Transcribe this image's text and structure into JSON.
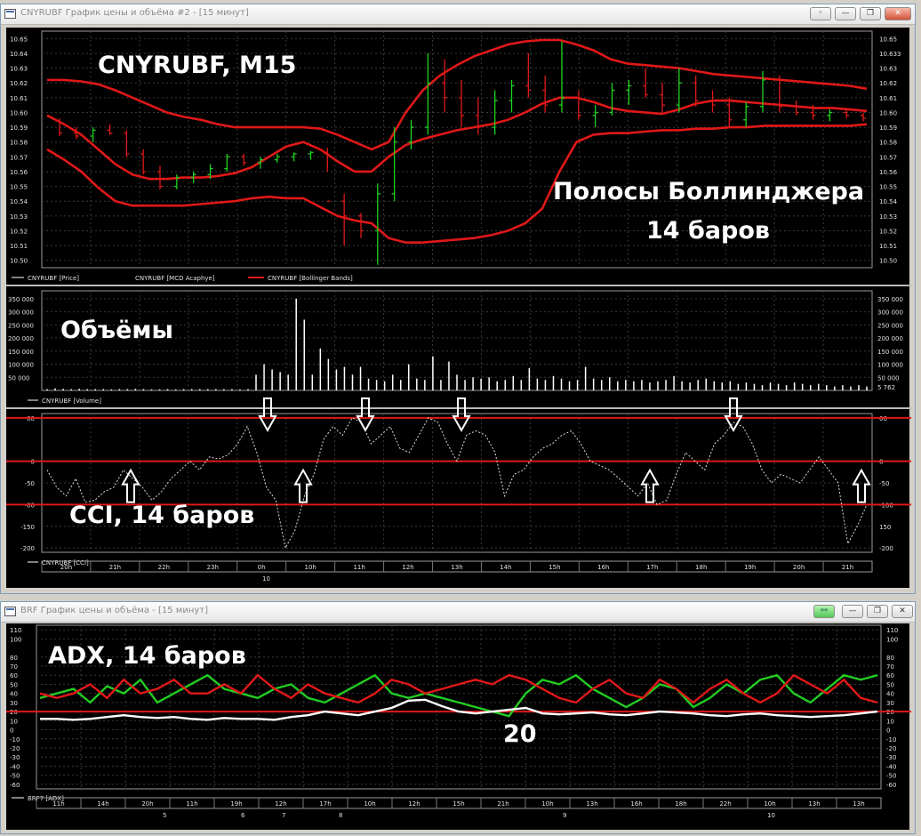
{
  "window1": {
    "title": "CNYRUBF График цены и объёма #2 - [15 минут]",
    "buttons": [
      "◦",
      "—",
      "❐",
      "✕"
    ]
  },
  "window2": {
    "title": "BRF График цены и объёма - [15 минут]",
    "buttons": [
      "⚯",
      "—",
      "❐",
      "✕"
    ]
  },
  "annotations": {
    "instrument": "CNYRUBF, M15",
    "bollinger_1": "Полосы Боллинджера",
    "bollinger_2": "14 баров",
    "volumes": "Объёмы",
    "cci": "CCI, 14 баров",
    "adx": "ADX, 14 баров",
    "adx_level": "20"
  },
  "colors": {
    "background": "#000000",
    "grid": "#3a3a3a",
    "bollinger": "#e01818",
    "bull": "#1fd41f",
    "bear": "#e01818",
    "axis_text": "#e0e0e0",
    "adx_green": "#22cc22",
    "adx_white": "#ffffff"
  },
  "chart_data": [
    {
      "type": "candlestick",
      "name": "price",
      "legend": [
        "CNYRUBF [Price]",
        "CNYRUBF [MCD Acaphye]",
        "CNYRUBF [Bollinger Bands]"
      ],
      "ylim": [
        10.495,
        10.655
      ],
      "yticks": [
        10.65,
        10.64,
        10.63,
        10.62,
        10.61,
        10.6,
        10.59,
        10.58,
        10.57,
        10.56,
        10.55,
        10.54,
        10.53,
        10.52,
        10.51,
        10.5
      ],
      "yticks_left": [
        "10.65",
        "10.64",
        "10.63",
        "10.62",
        "10.61",
        "10.60",
        "10.59",
        "10.58",
        "10.57",
        "10.56",
        "10.55",
        "10.54",
        "10.53",
        "10.52",
        "10.51",
        "10.50"
      ],
      "yticks_right": [
        "10.65",
        "10.633",
        "10.63",
        "10.62",
        "10.61",
        "10.60",
        "10.59",
        "10.58",
        "10.57",
        "10.56",
        "10.55",
        "10.54",
        "10.53",
        "10.52",
        "10.51",
        "10.50"
      ],
      "bollinger_upper": [
        10.622,
        10.622,
        10.621,
        10.619,
        10.615,
        10.61,
        10.605,
        10.6,
        10.597,
        10.595,
        10.592,
        10.59,
        10.59,
        10.59,
        10.59,
        10.59,
        10.589,
        10.585,
        10.58,
        10.575,
        10.58,
        10.6,
        10.615,
        10.625,
        10.632,
        10.638,
        10.642,
        10.646,
        10.648,
        10.649,
        10.649,
        10.646,
        10.642,
        10.636,
        10.633,
        10.632,
        10.631,
        10.63,
        10.628,
        10.626,
        10.625,
        10.624,
        10.623,
        10.622,
        10.621,
        10.62,
        10.619,
        10.618,
        10.616
      ],
      "bollinger_middle": [
        10.598,
        10.592,
        10.585,
        10.575,
        10.565,
        10.558,
        10.555,
        10.555,
        10.556,
        10.556,
        10.557,
        10.559,
        10.563,
        10.57,
        10.577,
        10.58,
        10.575,
        10.567,
        10.56,
        10.56,
        10.57,
        10.578,
        10.582,
        10.585,
        10.588,
        10.59,
        10.592,
        10.595,
        10.6,
        10.606,
        10.61,
        10.61,
        10.607,
        10.603,
        10.601,
        10.6,
        10.599,
        10.602,
        10.606,
        10.608,
        10.608,
        10.607,
        10.606,
        10.605,
        10.604,
        10.603,
        10.603,
        10.602,
        10.601
      ],
      "bollinger_lower": [
        10.575,
        10.568,
        10.56,
        10.549,
        10.54,
        10.537,
        10.537,
        10.537,
        10.537,
        10.538,
        10.539,
        10.54,
        10.542,
        10.543,
        10.542,
        10.542,
        10.536,
        10.53,
        10.527,
        10.525,
        10.515,
        10.512,
        10.512,
        10.513,
        10.514,
        10.515,
        10.517,
        10.52,
        10.525,
        10.535,
        10.56,
        10.58,
        10.585,
        10.586,
        10.586,
        10.587,
        10.588,
        10.588,
        10.589,
        10.589,
        10.59,
        10.59,
        10.591,
        10.591,
        10.591,
        10.591,
        10.591,
        10.591,
        10.592
      ],
      "candles_ohlc": [
        [
          10.594,
          10.596,
          10.584,
          10.586
        ],
        [
          10.586,
          10.59,
          10.582,
          10.584
        ],
        [
          10.584,
          10.59,
          10.58,
          10.588
        ],
        [
          10.588,
          10.592,
          10.585,
          10.586
        ],
        [
          10.586,
          10.588,
          10.57,
          10.572
        ],
        [
          10.572,
          10.575,
          10.558,
          10.56
        ],
        [
          10.56,
          10.564,
          10.548,
          10.55
        ],
        [
          10.55,
          10.558,
          10.548,
          10.556
        ],
        [
          10.556,
          10.56,
          10.552,
          10.558
        ],
        [
          10.558,
          10.565,
          10.555,
          10.562
        ],
        [
          10.562,
          10.572,
          10.56,
          10.57
        ],
        [
          10.57,
          10.572,
          10.564,
          10.566
        ],
        [
          10.566,
          10.57,
          10.562,
          10.568
        ],
        [
          10.568,
          10.572,
          10.566,
          10.57
        ],
        [
          10.57,
          10.573,
          10.567,
          10.572
        ],
        [
          10.572,
          10.574,
          10.568,
          10.573
        ],
        [
          10.573,
          10.576,
          10.56,
          10.54
        ],
        [
          10.54,
          10.545,
          10.51,
          10.53
        ],
        [
          10.53,
          10.532,
          10.515,
          10.52
        ],
        [
          10.52,
          10.552,
          10.497,
          10.545
        ],
        [
          10.545,
          10.59,
          10.54,
          10.58
        ],
        [
          10.58,
          10.595,
          10.575,
          10.59
        ],
        [
          10.59,
          10.64,
          10.585,
          10.62
        ],
        [
          10.62,
          10.636,
          10.6,
          10.61
        ],
        [
          10.61,
          10.622,
          10.59,
          10.598
        ],
        [
          10.598,
          10.61,
          10.585,
          10.59
        ],
        [
          10.59,
          10.615,
          10.585,
          10.608
        ],
        [
          10.608,
          10.622,
          10.6,
          10.618
        ],
        [
          10.618,
          10.64,
          10.61,
          10.615
        ],
        [
          10.615,
          10.625,
          10.6,
          10.605
        ],
        [
          10.605,
          10.648,
          10.6,
          10.61
        ],
        [
          10.61,
          10.615,
          10.595,
          10.598
        ],
        [
          10.598,
          10.605,
          10.59,
          10.6
        ],
        [
          10.6,
          10.62,
          10.598,
          10.615
        ],
        [
          10.615,
          10.622,
          10.605,
          10.618
        ],
        [
          10.618,
          10.63,
          10.61,
          10.612
        ],
        [
          10.612,
          10.62,
          10.6,
          10.605
        ],
        [
          10.605,
          10.63,
          10.6,
          10.62
        ],
        [
          10.62,
          10.625,
          10.604,
          10.608
        ],
        [
          10.608,
          10.615,
          10.6,
          10.605
        ],
        [
          10.605,
          10.61,
          10.59,
          10.595
        ],
        [
          10.595,
          10.607,
          10.59,
          10.604
        ],
        [
          10.604,
          10.628,
          10.6,
          10.622
        ],
        [
          10.622,
          10.625,
          10.6,
          10.604
        ],
        [
          10.604,
          10.608,
          10.598,
          10.6
        ],
        [
          10.6,
          10.605,
          10.595,
          10.598
        ],
        [
          10.598,
          10.602,
          10.594,
          10.6
        ],
        [
          10.6,
          10.603,
          10.596,
          10.598
        ],
        [
          10.598,
          10.6,
          10.594,
          10.596
        ]
      ]
    },
    {
      "type": "bar",
      "name": "volume",
      "legend": [
        "CNYRUBF [Volume]"
      ],
      "ylim": [
        0,
        380000
      ],
      "yticks": [
        "350 000",
        "300 000",
        "250 000",
        "200 000",
        "150 000",
        "100 000",
        "50 000"
      ],
      "yticks_right": [
        "350 000",
        "300 000",
        "250 000",
        "200 000",
        "150 000",
        "100 000",
        "50 000",
        "5 762"
      ],
      "values": [
        5000,
        8000,
        6000,
        5000,
        6000,
        5000,
        5000,
        5000,
        4000,
        5000,
        5000,
        6000,
        5000,
        4000,
        4000,
        5000,
        4000,
        5000,
        5000,
        5000,
        5000,
        5000,
        5000,
        5000,
        4000,
        5000,
        60000,
        100000,
        80000,
        70000,
        60000,
        350000,
        270000,
        60000,
        160000,
        120000,
        80000,
        90000,
        60000,
        90000,
        45000,
        40000,
        35000,
        60000,
        40000,
        100000,
        45000,
        40000,
        130000,
        40000,
        110000,
        60000,
        40000,
        50000,
        45000,
        50000,
        35000,
        40000,
        55000,
        40000,
        85000,
        45000,
        40000,
        55000,
        45000,
        35000,
        40000,
        90000,
        45000,
        40000,
        50000,
        35000,
        40000,
        35000,
        40000,
        30000,
        35000,
        40000,
        55000,
        35000,
        30000,
        40000,
        45000,
        35000,
        30000,
        35000,
        25000,
        30000,
        25000,
        20000,
        30000,
        25000,
        20000,
        30000,
        25000,
        20000,
        25000,
        20000,
        15000,
        20000,
        15000,
        20000,
        15000
      ]
    },
    {
      "type": "line",
      "name": "cci",
      "legend": [
        "CNYRUBF [CCI]"
      ],
      "ylim": [
        -210,
        110
      ],
      "yticks_left": [
        "00",
        "0",
        "-50",
        "-00",
        "-150",
        "-200"
      ],
      "yticks_right": [
        "00",
        "0",
        "-50",
        "-100",
        "150",
        "-200"
      ],
      "levels": [
        100,
        0,
        -100
      ],
      "values": [
        -20,
        -60,
        -80,
        -40,
        -95,
        -90,
        -70,
        -60,
        -20,
        -40,
        -60,
        -90,
        -70,
        -40,
        -20,
        0,
        -20,
        10,
        5,
        15,
        40,
        80,
        20,
        -60,
        -90,
        -200,
        -160,
        -80,
        -30,
        50,
        80,
        60,
        100,
        90,
        40,
        60,
        80,
        30,
        20,
        60,
        100,
        90,
        40,
        0,
        60,
        70,
        60,
        20,
        -80,
        -30,
        -20,
        10,
        30,
        40,
        60,
        70,
        40,
        0,
        -10,
        -20,
        -40,
        -60,
        -80,
        -50,
        -100,
        -90,
        -30,
        20,
        0,
        -20,
        40,
        60,
        90,
        80,
        40,
        -20,
        -50,
        -30,
        -40,
        -50,
        -20,
        10,
        -20,
        -50,
        -190,
        -150,
        -100
      ]
    }
  ],
  "time_axis_1": [
    "20h",
    "21h",
    "22h",
    "23h",
    "0h",
    "10h",
    "11h",
    "12h",
    "13h",
    "14h",
    "15h",
    "16h",
    "17h",
    "18h",
    "19h",
    "20h",
    "21h"
  ],
  "date_axis_1": [
    "10"
  ],
  "adx_chart": {
    "type": "line",
    "legend": [
      "BRF7 [ADX]"
    ],
    "ylim": [
      -65,
      115
    ],
    "yticks_left": [
      "110",
      "100",
      "80",
      "70",
      "60",
      "50",
      "40",
      "30",
      "20",
      "10",
      "0",
      "-10",
      "-20",
      "-30",
      "-40",
      "-50",
      "-60"
    ],
    "yticks_right": [
      "110",
      "100",
      "80",
      "70",
      "60",
      "50",
      "40",
      "30",
      "20",
      "10",
      "0",
      "-10",
      "-20",
      "-30",
      "-40",
      "-50",
      "-60"
    ],
    "level": 20,
    "series": [
      {
        "name": "+DI",
        "color": "green",
        "values": [
          35,
          40,
          45,
          30,
          48,
          40,
          55,
          30,
          40,
          50,
          60,
          45,
          40,
          35,
          45,
          50,
          35,
          30,
          40,
          50,
          60,
          40,
          35,
          40,
          35,
          30,
          25,
          20,
          15,
          40,
          55,
          50,
          60,
          45,
          35,
          25,
          35,
          50,
          45,
          25,
          35,
          50,
          40,
          55,
          60,
          40,
          30,
          45,
          60,
          55,
          60
        ]
      },
      {
        "name": "-DI",
        "color": "red",
        "values": [
          40,
          35,
          40,
          50,
          35,
          55,
          40,
          45,
          55,
          40,
          40,
          50,
          40,
          60,
          45,
          35,
          50,
          40,
          35,
          30,
          40,
          55,
          50,
          40,
          45,
          50,
          55,
          50,
          60,
          55,
          45,
          35,
          30,
          45,
          55,
          40,
          35,
          55,
          45,
          30,
          45,
          55,
          40,
          30,
          40,
          60,
          50,
          40,
          55,
          35,
          30
        ]
      },
      {
        "name": "ADX",
        "color": "white",
        "values": [
          12,
          12,
          11,
          12,
          14,
          16,
          14,
          13,
          14,
          12,
          11,
          13,
          12,
          12,
          11,
          14,
          16,
          20,
          18,
          16,
          20,
          24,
          32,
          33,
          26,
          20,
          18,
          20,
          22,
          24,
          18,
          17,
          18,
          19,
          17,
          16,
          18,
          20,
          19,
          18,
          16,
          15,
          17,
          18,
          16,
          15,
          14,
          15,
          16,
          18,
          20
        ]
      }
    ]
  },
  "time_axis_2": [
    "11h",
    "14h",
    "20h",
    "11h",
    "19h",
    "12h",
    "17h",
    "10h",
    "12h",
    "15h",
    "21h",
    "10h",
    "13h",
    "16h",
    "18h",
    "22h",
    "10h",
    "13h",
    "13h"
  ],
  "date_axis_2": [
    "5",
    "6",
    "7",
    "8",
    "9",
    "10"
  ]
}
